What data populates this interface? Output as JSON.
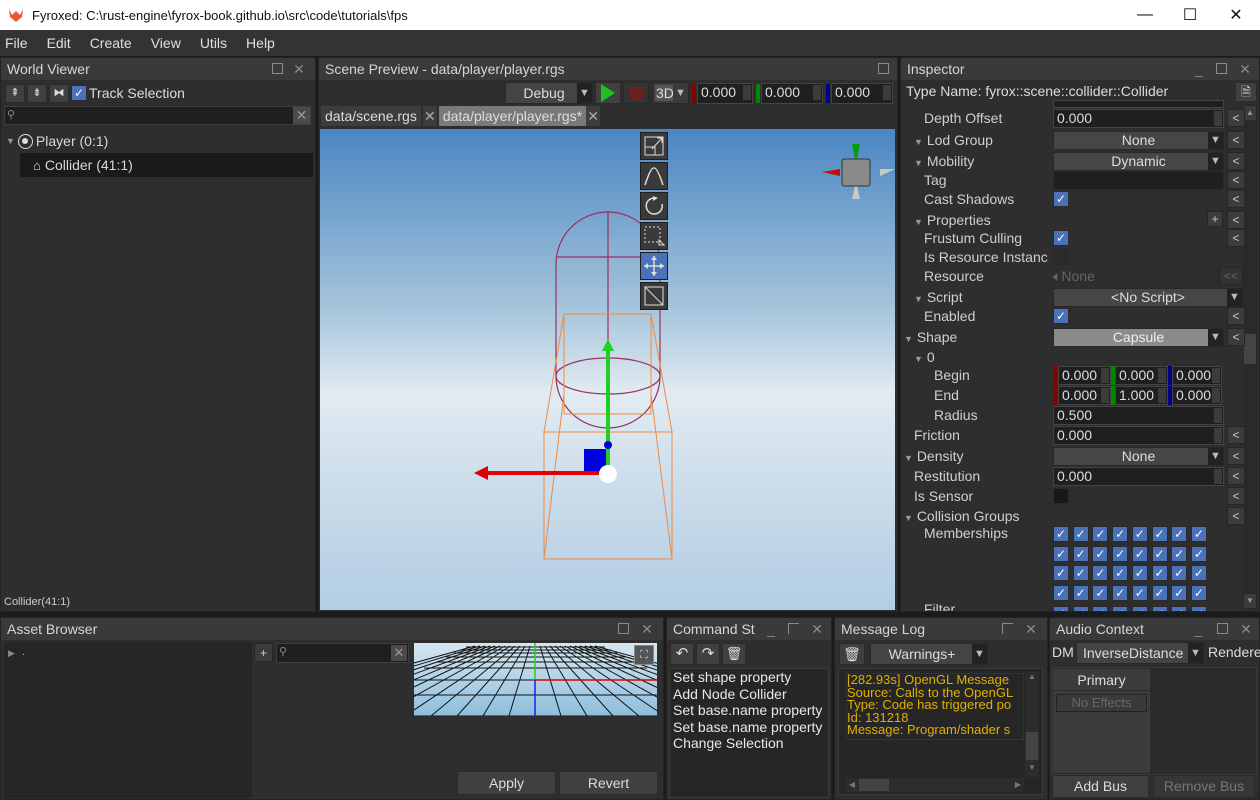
{
  "window": {
    "title": "Fyroxed: C:\\rust-engine\\fyrox-book.github.io\\src\\code\\tutorials\\fps",
    "controls": {
      "minimize": "—",
      "maximize": "☐",
      "close": "✕"
    }
  },
  "menu": [
    "File",
    "Edit",
    "Create",
    "View",
    "Utils",
    "Help"
  ],
  "world_viewer": {
    "title": "World Viewer",
    "track_selection_label": "Track Selection",
    "track_selection_checked": true,
    "search_placeholder": "",
    "tree": [
      {
        "label": "Player (0:1)",
        "icon": "pivot-icon",
        "expanded": true
      },
      {
        "label": "Collider (41:1)",
        "icon": "collider-icon",
        "selected": true
      }
    ],
    "status": "Collider(41:1)"
  },
  "scene_preview": {
    "title": "Scene Preview - data/player/player.rgs",
    "build_mode": "Debug",
    "view_mode": "3D",
    "coords": {
      "x": "0.000",
      "y": "0.000",
      "z": "0.000"
    },
    "tabs": [
      {
        "label": "data/scene.rgs",
        "active": false
      },
      {
        "label": "data/player/player.rgs*",
        "active": true
      }
    ],
    "tools": [
      "scale-tool",
      "terrain-tool",
      "rotate-tool",
      "select-tool",
      "move-tool",
      "navmesh-tool"
    ],
    "active_tool": "move-tool"
  },
  "inspector": {
    "title": "Inspector",
    "type_name": "Type Name: fyrox::scene::collider::Collider",
    "rows": {
      "depth_offset": {
        "label": "Depth Offset",
        "value": "0.000"
      },
      "lod_group": {
        "label": "Lod Group",
        "value": "None"
      },
      "mobility": {
        "label": "Mobility",
        "value": "Dynamic"
      },
      "tag": {
        "label": "Tag",
        "value": ""
      },
      "cast_shadows": {
        "label": "Cast Shadows",
        "checked": true
      },
      "properties": {
        "label": "Properties"
      },
      "frustum_culling": {
        "label": "Frustum Culling",
        "checked": true
      },
      "is_resource_instance": {
        "label": "Is Resource Instanc",
        "checked": false
      },
      "resource": {
        "label": "Resource",
        "value": "None"
      },
      "script": {
        "label": "Script",
        "value": "<No Script>"
      },
      "enabled": {
        "label": "Enabled",
        "checked": true
      },
      "shape": {
        "label": "Shape",
        "value": "Capsule"
      },
      "shape_index": {
        "label": "0"
      },
      "begin": {
        "label": "Begin",
        "x": "0.000",
        "y": "0.000",
        "z": "0.000"
      },
      "end": {
        "label": "End",
        "x": "0.000",
        "y": "1.000",
        "z": "0.000"
      },
      "radius": {
        "label": "Radius",
        "value": "0.500"
      },
      "friction": {
        "label": "Friction",
        "value": "0.000"
      },
      "density": {
        "label": "Density",
        "value": "None"
      },
      "restitution": {
        "label": "Restitution",
        "value": "0.000"
      },
      "is_sensor": {
        "label": "Is Sensor",
        "checked": false
      },
      "collision_groups": {
        "label": "Collision Groups"
      },
      "memberships": {
        "label": "Memberships",
        "bits_checked": 32
      },
      "filter": {
        "label": "Filter"
      }
    },
    "reset_label": "<",
    "reset_all_label": "<<",
    "add_label": "+"
  },
  "asset_browser": {
    "title": "Asset Browser",
    "root_folder": ".",
    "search_placeholder": "",
    "apply_label": "Apply",
    "revert_label": "Revert"
  },
  "command_stack": {
    "title": "Command St",
    "items": [
      "Set shape property",
      "Add Node Collider",
      "Set base.name property",
      "Set base.name property",
      "Change Selection"
    ]
  },
  "message_log": {
    "title": "Message Log",
    "filter": "Warnings+",
    "lines": [
      "[282.93s] OpenGL Message",
      " Source: Calls to the OpenGL",
      " Type: Code has triggered po",
      " Id: 131218",
      " Message: Program/shader s"
    ]
  },
  "audio_context": {
    "title": "Audio Context",
    "dm_label": "DM",
    "distance_model": "InverseDistance",
    "renderer_label": "Rendere",
    "bus_name": "Primary",
    "effects_label": "No Effects",
    "add_bus_label": "Add Bus",
    "remove_bus_label": "Remove Bus"
  },
  "colors": {
    "accent": "#4a72b8",
    "axis_x": "#e00000",
    "axis_y": "#00cc00",
    "axis_z": "#0000dd",
    "log_warning": "#e0b000",
    "play": "#1fc01f"
  }
}
